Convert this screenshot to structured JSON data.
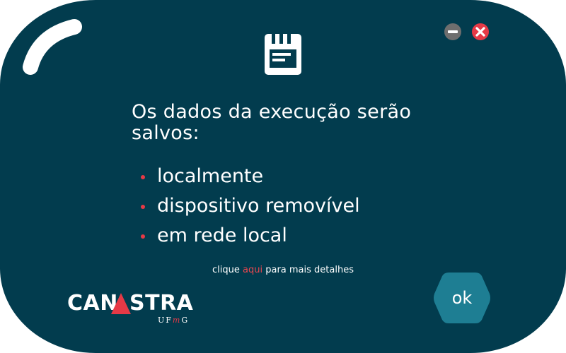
{
  "dialog": {
    "heading": "Os dados da execução serão salvos:",
    "options": [
      "localmente",
      "dispositivo removível",
      "em rede local"
    ],
    "details": {
      "prefix": "clique",
      "link": "aqui",
      "suffix": "para mais detalhes"
    },
    "ok_label": "ok"
  },
  "logo": {
    "left": "CAN",
    "right": "STRA",
    "sub_u": "U",
    "sub_f": "F",
    "sub_m": "m",
    "sub_g": "G"
  },
  "icons": {
    "save": "floppy-disk-icon",
    "minimize": "minimize-icon",
    "close": "close-icon"
  },
  "colors": {
    "background": "#023c4e",
    "accent_red": "#e63946",
    "button_teal": "#1e7e93",
    "minimize_gray": "#6e6e6e",
    "text": "#ffffff"
  }
}
